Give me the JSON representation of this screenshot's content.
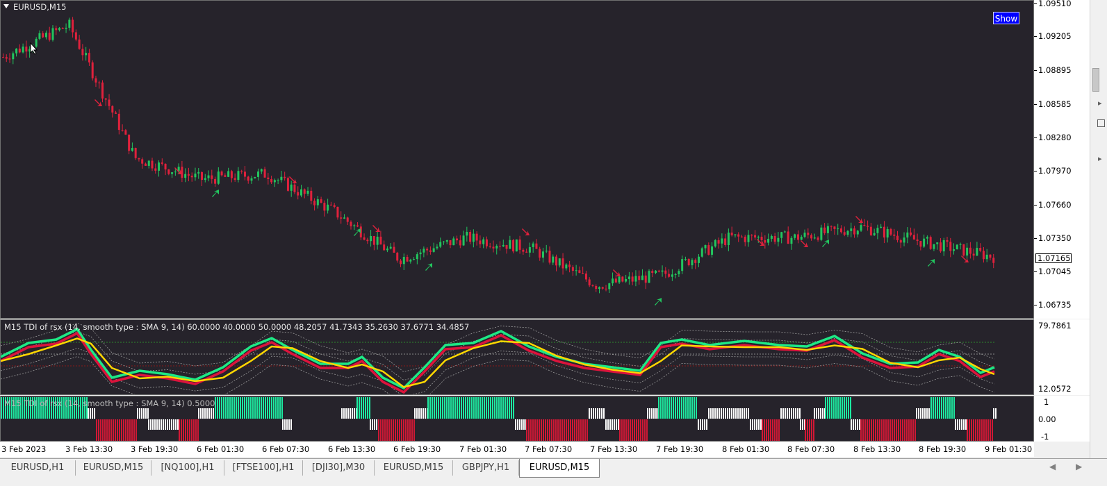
{
  "window": {
    "title": "EURUSD,M15",
    "show_button": "Show"
  },
  "price_axis": {
    "labels": [
      "1.09510",
      "1.09205",
      "1.08895",
      "1.08585",
      "1.08280",
      "1.07970",
      "1.07660",
      "1.07350",
      "1.07045",
      "1.06735"
    ],
    "current_price": "1.07165"
  },
  "indicator1": {
    "title": "M15 TDI of rsx  (14, smooth type :  SMA 9, 14) 60.0000 40.0000 50.0000 48.2057 41.7343 35.2630 37.6771 34.4857",
    "axis_top": "79.7861",
    "axis_bottom": "12.0572"
  },
  "indicator2": {
    "title": "M15 TDI of rsx  (14, smooth type :  SMA 9, 14) 0.5000",
    "axis_labels": [
      "1",
      "0.00",
      "-1"
    ]
  },
  "time_axis": [
    "3 Feb 2023",
    "3 Feb 13:30",
    "3 Feb 19:30",
    "6 Feb 01:30",
    "6 Feb 07:30",
    "6 Feb 13:30",
    "6 Feb 19:30",
    "7 Feb 01:30",
    "7 Feb 07:30",
    "7 Feb 13:30",
    "7 Feb 19:30",
    "8 Feb 01:30",
    "8 Feb 07:30",
    "8 Feb 13:30",
    "8 Feb 19:30",
    "9 Feb 01:30"
  ],
  "tabs": [
    "EURUSD,H1",
    "EURUSD,M15",
    "[NQ100],H1",
    "[FTSE100],H1",
    "[DJI30],M30",
    "EURUSD,M15",
    "GBPJPY,H1",
    "EURUSD,M15"
  ],
  "active_tab": 7,
  "colors": {
    "bull": "#22c55e",
    "bear": "#e0213c",
    "bg": "#26232b",
    "tdi_green": "#1de985",
    "tdi_red": "#dc143c",
    "tdi_yellow": "#ffd700",
    "histo_green": "#1de9a0",
    "histo_red": "#d01835",
    "histo_white": "#ffffff"
  },
  "chart_data": {
    "type": "line",
    "title": "EURUSD,M15",
    "x": [
      "3 Feb 2023",
      "3 Feb 13:30",
      "3 Feb 19:30",
      "6 Feb 01:30",
      "6 Feb 07:30",
      "6 Feb 13:30",
      "6 Feb 19:30",
      "7 Feb 01:30",
      "7 Feb 07:30",
      "7 Feb 13:30",
      "7 Feb 19:30",
      "8 Feb 01:30",
      "8 Feb 07:30",
      "8 Feb 13:30",
      "8 Feb 19:30",
      "9 Feb 01:30"
    ],
    "series": [
      {
        "values": [
          1.0905,
          1.0935,
          1.081,
          1.079,
          1.0795,
          1.076,
          1.0715,
          1.0735,
          1.0725,
          1.069,
          1.07,
          1.0735,
          1.0735,
          1.0745,
          1.073,
          1.0717
        ]
      }
    ],
    "ylim": [
      1.0658,
      1.0958
    ]
  }
}
